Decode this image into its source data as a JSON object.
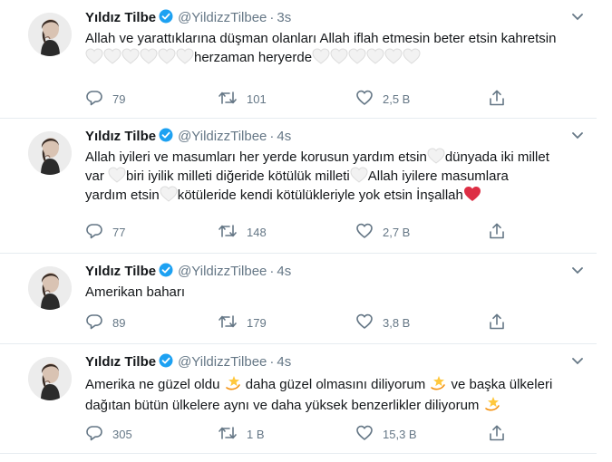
{
  "tweets": [
    {
      "name": "Yıldız Tilbe",
      "handle": "@YildizzTilbee",
      "separator": "·",
      "time": "3s",
      "text_line1": "Allah ve yarattıklarına düşman olanları Allah iflah etmesin beter etsin kahretsin",
      "text_seg2": "herzaman heryerde",
      "replies": "79",
      "retweets": "101",
      "likes": "2,5 B"
    },
    {
      "name": "Yıldız Tilbe",
      "handle": "@YildizzTilbee",
      "separator": "·",
      "time": "4s",
      "seg_a": "Allah iyileri ve masumları her yerde korusun yardım etsin",
      "seg_b": "dünyada iki millet",
      "seg_c": "var",
      "seg_d": "biri iyilik milleti diğeride kötülük milleti",
      "seg_e": "Allah iyilere masumlara",
      "seg_f": "yardım etsin",
      "seg_g": "kötüleride kendi kötülükleriyle yok etsin İnşallah",
      "replies": "77",
      "retweets": "148",
      "likes": "2,7 B"
    },
    {
      "name": "Yıldız Tilbe",
      "handle": "@YildizzTilbee",
      "separator": "·",
      "time": "4s",
      "text": "Amerikan baharı",
      "replies": "89",
      "retweets": "179",
      "likes": "3,8 B"
    },
    {
      "name": "Yıldız Tilbe",
      "handle": "@YildizzTilbee",
      "separator": "·",
      "time": "4s",
      "seg_a": "Amerika ne güzel oldu",
      "seg_b": "daha güzel olmasını diliyorum",
      "seg_c": "ve başka ülkeleri",
      "seg_d": "dağıtan bütün ülkelere aynı ve daha yüksek benzerlikler diliyorum",
      "replies": "305",
      "retweets": "1 B",
      "likes": "15,3 B"
    }
  ],
  "icons": {
    "reply": "reply-icon",
    "retweet": "retweet-icon",
    "like": "heart-icon",
    "share": "share-icon",
    "verified": "verified-badge-icon",
    "caret": "chevron-down-icon",
    "white_heart": "white-heart-emoji",
    "red_heart": "red-heart-emoji",
    "dizzy": "dizzy-star-emoji"
  },
  "colors": {
    "text": "#14171a",
    "secondary": "#657786",
    "verified": "#1da1f2",
    "divider": "#e6ecf0",
    "white_heart_fill": "#f2f2f2",
    "white_heart_stroke": "#dcdcdc",
    "red_heart": "#dd2e44",
    "dizzy": "#ffc83d"
  }
}
